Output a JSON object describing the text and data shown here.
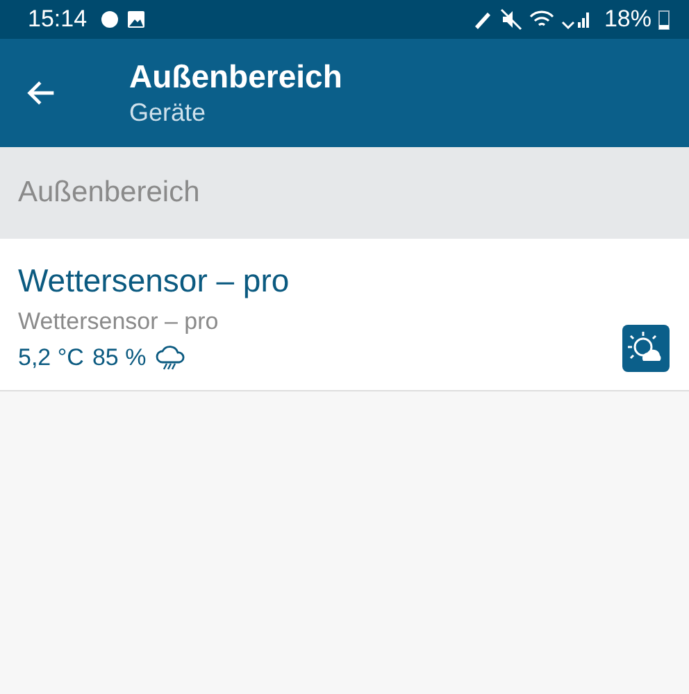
{
  "status_bar": {
    "time": "15:14",
    "battery": "18%"
  },
  "app_bar": {
    "title": "Außenbereich",
    "subtitle": "Geräte"
  },
  "section": {
    "title": "Außenbereich"
  },
  "devices": [
    {
      "name": "Wettersensor – pro",
      "type": "Wettersensor – pro",
      "temperature": "5,2 °C",
      "humidity": "85 %"
    }
  ]
}
